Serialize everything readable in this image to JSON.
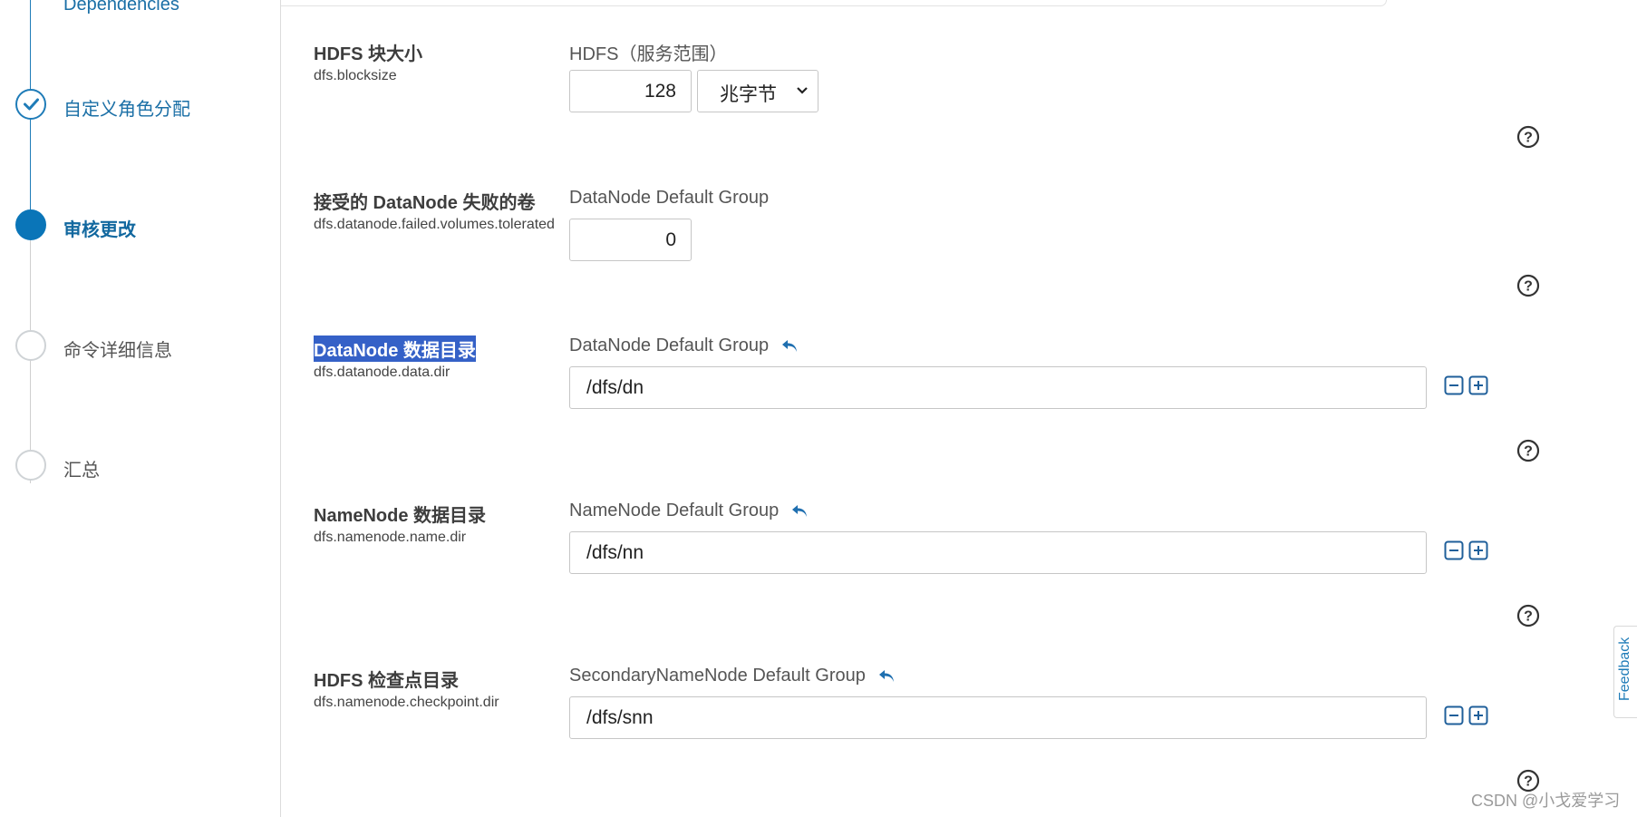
{
  "sidebar": {
    "cut_item": "Dependencies",
    "steps": [
      {
        "label": "自定义角色分配",
        "state": "done"
      },
      {
        "label": "审核更改",
        "state": "active"
      },
      {
        "label": "命令详细信息",
        "state": "pending"
      },
      {
        "label": "汇总",
        "state": "pending"
      }
    ]
  },
  "rows": [
    {
      "name": "HDFS 块大小",
      "key": "dfs.blocksize",
      "scope": "HDFS（服务范围）",
      "value": "128",
      "unit": "兆字节"
    },
    {
      "name": "接受的 DataNode 失败的卷",
      "key": "dfs.datanode.failed.volumes.tolerated",
      "scope": "DataNode Default Group",
      "value": "0"
    },
    {
      "name": "DataNode 数据目录",
      "key": "dfs.datanode.data.dir",
      "scope": "DataNode Default Group",
      "value": "/dfs/dn"
    },
    {
      "name": "NameNode 数据目录",
      "key": "dfs.namenode.name.dir",
      "scope": "NameNode Default Group",
      "value": "/dfs/nn"
    },
    {
      "name": "HDFS 检查点目录",
      "key": "dfs.namenode.checkpoint.dir",
      "scope": "SecondaryNameNode Default Group",
      "value": "/dfs/snn"
    }
  ],
  "feedback_label": "Feedback",
  "watermark": "CSDN @小戈爱学习",
  "colors": {
    "accent": "#0a75b8",
    "highlight": "#3561c7"
  }
}
